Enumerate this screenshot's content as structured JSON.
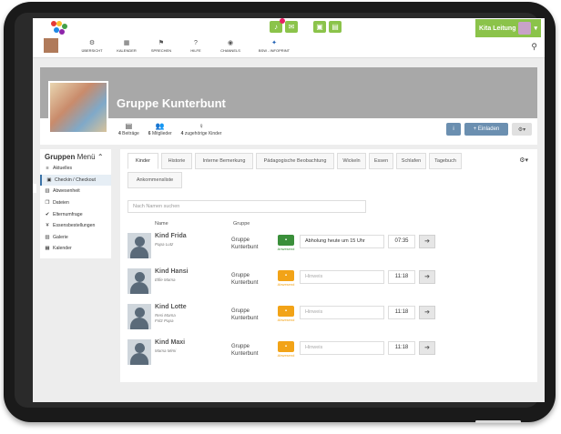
{
  "topbar": {
    "kita_label": "Kita Leitung",
    "nav": [
      {
        "label": "Übersicht",
        "icon": "dashboard-icon"
      },
      {
        "label": "Kalender",
        "icon": "calendar-icon"
      },
      {
        "label": "Sprechen",
        "icon": "flag-icon"
      },
      {
        "label": "Hilfe",
        "icon": "help-icon"
      },
      {
        "label": "Channels",
        "icon": "globe-icon"
      },
      {
        "label": "BSW - Infoprint",
        "icon": "bsw-logo-icon"
      }
    ],
    "accent": "#8bc34a"
  },
  "hero": {
    "title": "Gruppe Kunterbunt",
    "stats": [
      {
        "count": "4",
        "label": "Beiträge"
      },
      {
        "count": "6",
        "label": "Mitglieder"
      },
      {
        "count": "4",
        "label": "zugehörige Kinder"
      }
    ],
    "invite_label": "+ Einladen",
    "info_label": "i"
  },
  "sidebar": {
    "title_bold": "Gruppen",
    "title_rest": " Menü",
    "items": [
      {
        "label": "Aktuelles",
        "icon": "list-icon",
        "active": false
      },
      {
        "label": "Checkin / Checkout",
        "icon": "checkin-icon",
        "active": true
      },
      {
        "label": "Abwesenheit",
        "icon": "absence-icon",
        "active": false
      },
      {
        "label": "Dateien",
        "icon": "files-icon",
        "active": false
      },
      {
        "label": "Elternumfrage",
        "icon": "check-icon",
        "active": false
      },
      {
        "label": "Essensbestellungen",
        "icon": "cutlery-icon",
        "active": false
      },
      {
        "label": "Galerie",
        "icon": "image-icon",
        "active": false
      },
      {
        "label": "Kalender",
        "icon": "calendar-icon",
        "active": false
      }
    ]
  },
  "tabs": [
    "Kinder",
    "Historie",
    "Interne Bemerkung",
    "Pädagogische Beobachtung",
    "Wickeln",
    "Essen",
    "Schlafen",
    "Tagebuch",
    "Ankommensliste"
  ],
  "search": {
    "placeholder": "Nach Namen suchen"
  },
  "columns": {
    "name": "Name",
    "group": "Gruppe"
  },
  "children": [
    {
      "name": "Kind Frida",
      "parents": "Papa Lutz",
      "group": "Gruppe Kunterbunt",
      "status": "Anwesend",
      "state": "present",
      "note": "Abholung heute um 15 Uhr",
      "time": "07:35"
    },
    {
      "name": "Kind Hansi",
      "parents": "Elfie Mama",
      "group": "Gruppe Kunterbunt",
      "status": "Abwesend",
      "state": "absent",
      "note": "",
      "time": "11:18"
    },
    {
      "name": "Kind Lotte",
      "parents": "Resi Mama\nFritz Papa",
      "group": "Gruppe Kunterbunt",
      "status": "Abwesend",
      "state": "absent",
      "note": "",
      "time": "11:18"
    },
    {
      "name": "Kind Maxi",
      "parents": "Mama Mimi",
      "group": "Gruppe Kunterbunt",
      "status": "Abwesend",
      "state": "absent",
      "note": "",
      "time": "11:18"
    }
  ],
  "note_placeholder": "Hinweis",
  "colors": {
    "present": "#3a8f3a",
    "absent": "#f2a317",
    "primary": "#6b8fb0"
  }
}
